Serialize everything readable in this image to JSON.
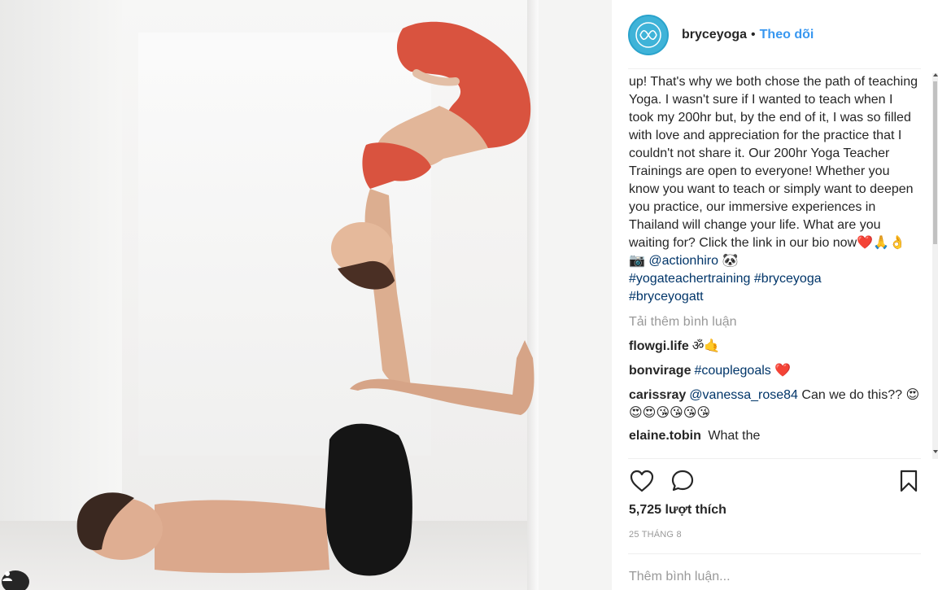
{
  "photo": {
    "alt_icon": "user-tag-icon"
  },
  "header": {
    "username": "bryceyoga",
    "separator": "•",
    "follow_label": "Theo dõi",
    "avatar_icon": "brand-logo-icon"
  },
  "caption": {
    "lines": [
      "up! That's why we both chose the path of teaching Yoga. I wasn't sure if I wanted to teach when I took my 200hr but, by the end of it, I was so filled with love and appreciation for the practice that I couldn't not share it. Our 200hr Yoga Teacher Trainings are open to everyone! Whether you know you want to teach or simply want to deepen you practice, our immersive experiences in Thailand will change your life. What are you waiting for? Click the link in our bio now"
    ],
    "emojis_after_text": "❤️🙏👌 📷",
    "mention": "@actionhiro",
    "panda": "🐼",
    "hashtags": [
      "#yogateachertraining",
      "#bryceyoga",
      "#bryceyogatt"
    ]
  },
  "load_more_label": "Tải thêm bình luận",
  "comments": [
    {
      "user": "flowgi.life",
      "text": "ॐ🤙",
      "mention": ""
    },
    {
      "user": "bonvirage",
      "text": " ❤️",
      "mention": "#couplegoals"
    },
    {
      "user": "carissray",
      "text": " Can we do this?? 😍😍😍😘😘😘😘",
      "mention": "@vanessa_rose84"
    },
    {
      "user": "elaine.tobin",
      "text": " What the",
      "mention": ""
    }
  ],
  "actions": {
    "like_icon": "heart-icon",
    "comment_icon": "comment-bubble-icon",
    "save_icon": "bookmark-icon"
  },
  "likes_text": "5,725 lượt thích",
  "date_text": "25 THÁNG 8",
  "add_comment_placeholder": "Thêm bình luận...",
  "colors": {
    "link": "#003569",
    "follow": "#3897f0",
    "muted": "#999999",
    "avatar": "#3fb3d8"
  }
}
